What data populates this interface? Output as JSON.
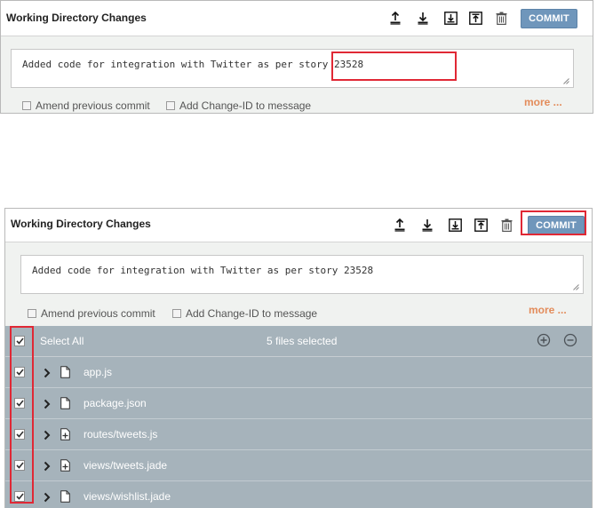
{
  "panel_top": {
    "title": "Working Directory Changes",
    "commit_label": "COMMIT",
    "message": "Added code for integration with Twitter as per story 23528",
    "amend_label": "Amend previous commit",
    "changeid_label": "Add Change-ID to message",
    "more_label": "more ..."
  },
  "panel_bottom": {
    "title": "Working Directory Changes",
    "commit_label": "COMMIT",
    "message": "Added code for integration with Twitter as per story 23528",
    "amend_label": "Amend previous commit",
    "changeid_label": "Add Change-ID to message",
    "more_label": "more ...",
    "select_all_label": "Select All",
    "selected_count": "5 files selected",
    "files": [
      {
        "name": "app.js",
        "icon": "file-icon"
      },
      {
        "name": "package.json",
        "icon": "file-icon"
      },
      {
        "name": "routes/tweets.js",
        "icon": "file-added-icon"
      },
      {
        "name": "views/tweets.jade",
        "icon": "file-added-icon"
      },
      {
        "name": "views/wishlist.jade",
        "icon": "file-icon"
      }
    ]
  },
  "colors": {
    "commit_button": "#6f96bb",
    "highlight_box": "#e02835",
    "more_link": "#e38c5b",
    "file_list_bg": "#a6b3bb"
  }
}
